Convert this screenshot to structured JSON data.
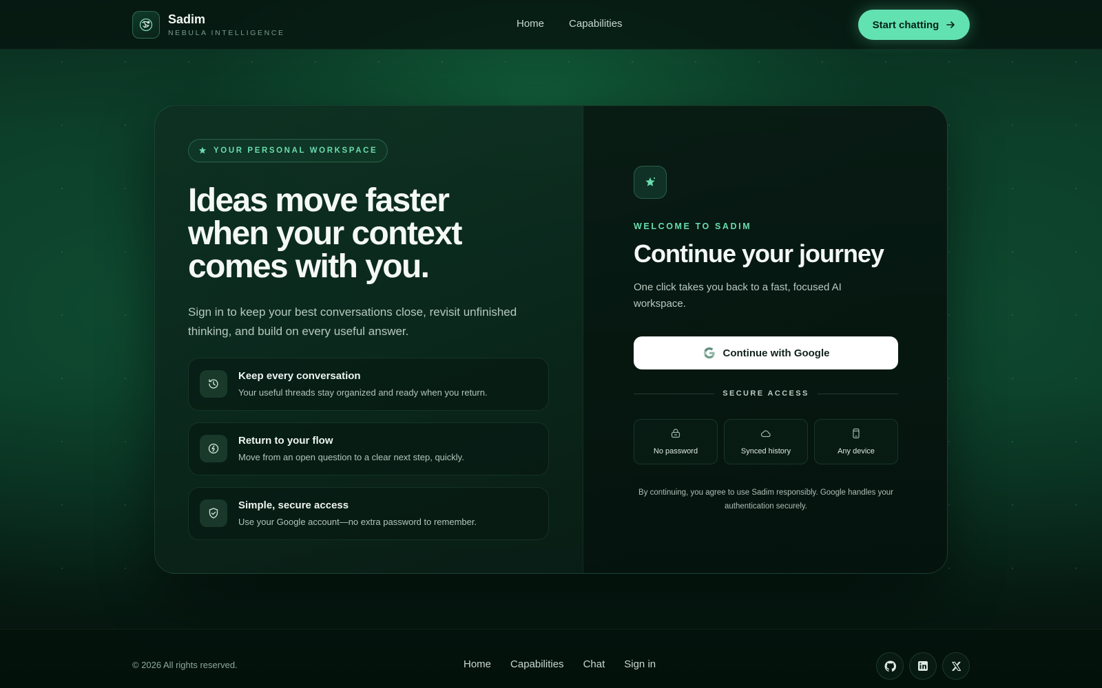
{
  "header": {
    "brand_name": "Sadim",
    "brand_tagline": "NEBULA INTELLIGENCE",
    "nav": [
      "Home",
      "Capabilities"
    ],
    "cta_label": "Start chatting"
  },
  "left": {
    "badge": "YOUR PERSONAL WORKSPACE",
    "headline": "Ideas move faster when your context comes with you.",
    "lead": "Sign in to keep your best conversations close, revisit unfinished thinking, and build on every useful answer.",
    "features": [
      {
        "icon": "history-icon",
        "title": "Keep every conversation",
        "desc": "Your useful threads stay organized and ready when you return."
      },
      {
        "icon": "flow-icon",
        "title": "Return to your flow",
        "desc": "Move from an open question to a clear next step, quickly."
      },
      {
        "icon": "shield-check-icon",
        "title": "Simple, secure access",
        "desc": "Use your Google account—no extra password to remember."
      }
    ]
  },
  "right": {
    "eyebrow": "WELCOME TO SADIM",
    "title": "Continue your journey",
    "subtitle": "One click takes you back to a fast, focused AI workspace.",
    "google_label": "Continue with Google",
    "divider_label": "SECURE ACCESS",
    "chips": [
      {
        "icon": "lock-icon",
        "label": "No password"
      },
      {
        "icon": "cloud-icon",
        "label": "Synced history"
      },
      {
        "icon": "device-icon",
        "label": "Any device"
      }
    ],
    "legal": "By continuing, you agree to use Sadim responsibly. Google handles your authentication securely."
  },
  "footer": {
    "copyright": "© 2026 All rights reserved.",
    "nav": [
      "Home",
      "Capabilities",
      "Chat",
      "Sign in"
    ],
    "social": [
      "github-icon",
      "linkedin-icon",
      "x-icon"
    ]
  },
  "colors": {
    "accent": "#63e2b1",
    "accent_text": "#69dcae",
    "background": "#0a3a27"
  }
}
